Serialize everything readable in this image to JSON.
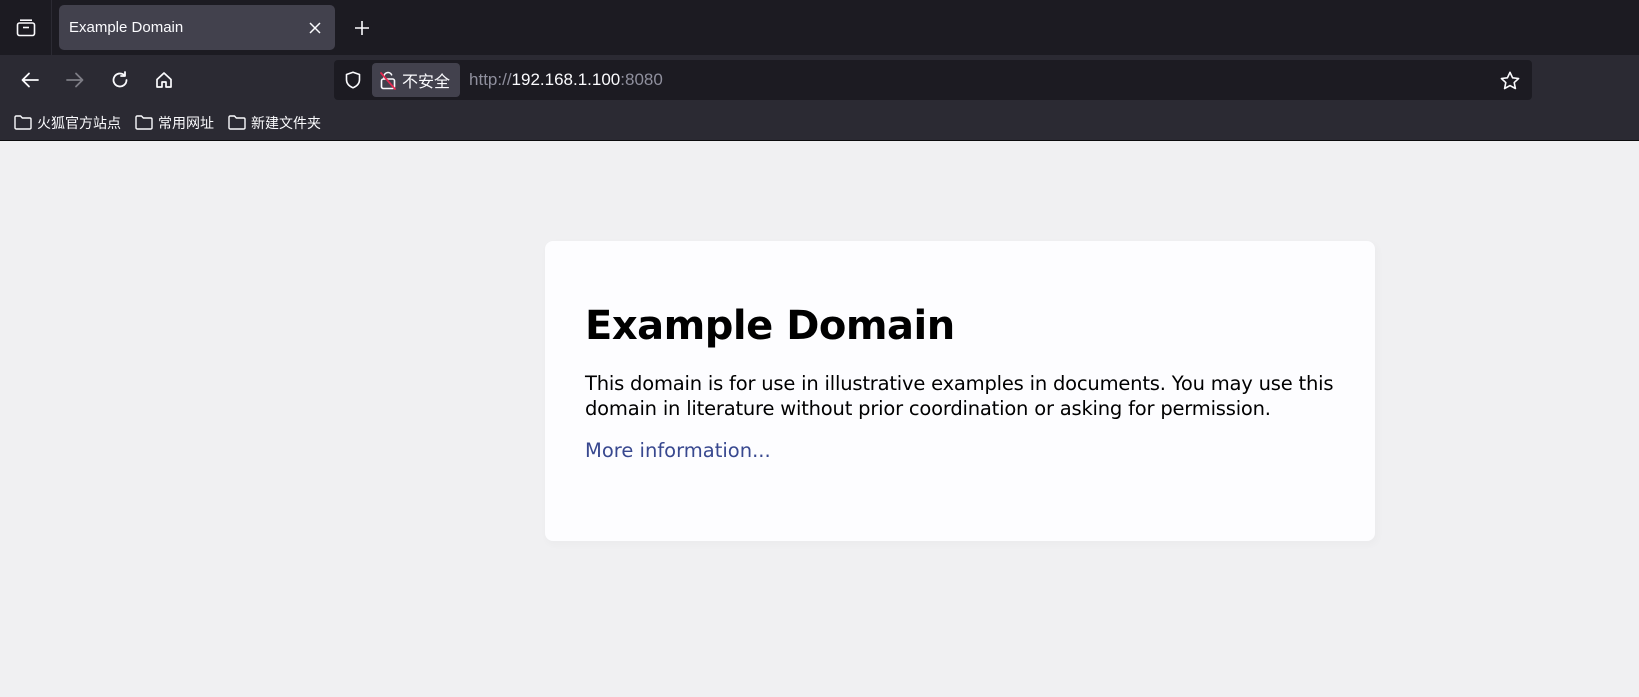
{
  "browser": {
    "tab": {
      "title": "Example Domain"
    },
    "urlbar": {
      "security_label": "不安全",
      "url_scheme": "http://",
      "url_host": "192.168.1.100",
      "url_port": ":8080"
    },
    "bookmarks": [
      {
        "label": "火狐官方站点",
        "icon": "folder-icon"
      },
      {
        "label": "常用网址",
        "icon": "folder-icon"
      },
      {
        "label": "新建文件夹",
        "icon": "folder-icon"
      }
    ],
    "icons": {
      "tab_list": "tab-list-icon",
      "close": "close-icon",
      "new_tab": "plus-icon",
      "back": "back-arrow-icon",
      "forward": "forward-arrow-icon",
      "reload": "reload-icon",
      "home": "home-icon",
      "shield": "shield-icon",
      "insecure_lock": "insecure-lock-icon",
      "bookmark_star": "star-icon"
    },
    "colors": {
      "tabstrip_bg": "#1c1b22",
      "toolbar_bg": "#2b2a33",
      "active_tab_bg": "#42414d",
      "insecure_slash": "#e22850"
    }
  },
  "page": {
    "heading": "Example Domain",
    "description": "This domain is for use in illustrative examples in documents. You may use this domain in literature without prior coordination or asking for permission.",
    "link_text": "More information...",
    "colors": {
      "background": "#f0f0f2",
      "card": "#fdfdff",
      "link": "#38488f"
    }
  }
}
